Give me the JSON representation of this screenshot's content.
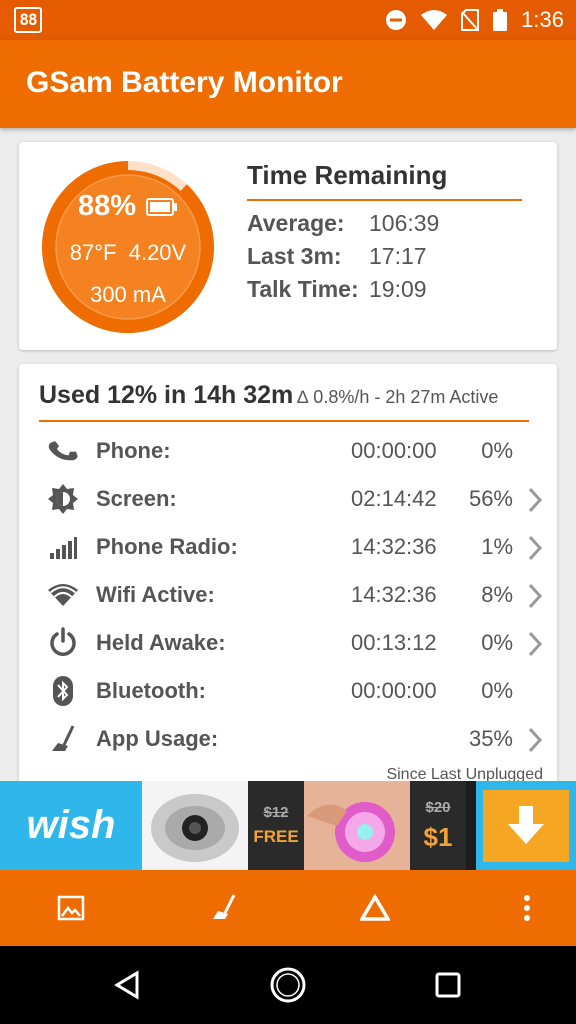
{
  "status_bar": {
    "notification_icon_text": "88",
    "time": "1:36",
    "icons": [
      "do-not-disturb-icon",
      "wifi-icon",
      "no-sim-icon",
      "battery-icon"
    ]
  },
  "app_bar": {
    "title": "GSam Battery Monitor"
  },
  "gauge": {
    "percent": "88%",
    "level": 0.88,
    "temperature": "87°F",
    "voltage": "4.20V",
    "current": "300 mA"
  },
  "time_remaining": {
    "title": "Time Remaining",
    "rows": [
      {
        "label": "Average:",
        "value": "106:39"
      },
      {
        "label": "Last 3m:",
        "value": "17:17"
      },
      {
        "label": "Talk Time:",
        "value": "19:09"
      }
    ]
  },
  "usage": {
    "title": "Used 12% in 14h 32m",
    "subtitle": "∆ 0.8%/h - 2h 27m Active",
    "rows": [
      {
        "icon": "phone-icon",
        "label": "Phone:",
        "time": "00:00:00",
        "percent": "0%",
        "chevron": false
      },
      {
        "icon": "brightness-icon",
        "label": "Screen:",
        "time": "02:14:42",
        "percent": "56%",
        "chevron": true
      },
      {
        "icon": "signal-bars-icon",
        "label": "Phone Radio:",
        "time": "14:32:36",
        "percent": "1%",
        "chevron": true
      },
      {
        "icon": "wifi-icon",
        "label": "Wifi Active:",
        "time": "14:32:36",
        "percent": "8%",
        "chevron": true
      },
      {
        "icon": "power-icon",
        "label": "Held Awake:",
        "time": "00:13:12",
        "percent": "0%",
        "chevron": true
      },
      {
        "icon": "bluetooth-icon",
        "label": "Bluetooth:",
        "time": "00:00:00",
        "percent": "0%",
        "chevron": false
      },
      {
        "icon": "broom-icon",
        "label": "App Usage:",
        "time": "",
        "percent": "35%",
        "chevron": true
      }
    ],
    "footer": "Since Last Unplugged"
  },
  "ad": {
    "brand": "wish",
    "offer1_old": "$12",
    "offer1_new": "FREE",
    "offer2_old": "$20",
    "offer2_new": "$1"
  },
  "toolbar": {
    "buttons": [
      "image-icon",
      "broom-icon",
      "delta-icon",
      "more-vert-icon"
    ]
  },
  "navbar": {
    "buttons": [
      "back-icon",
      "home-icon",
      "recents-icon"
    ]
  },
  "colors": {
    "primary": "#ef6c00",
    "status_bar": "#e55b00",
    "text": "#555555"
  }
}
